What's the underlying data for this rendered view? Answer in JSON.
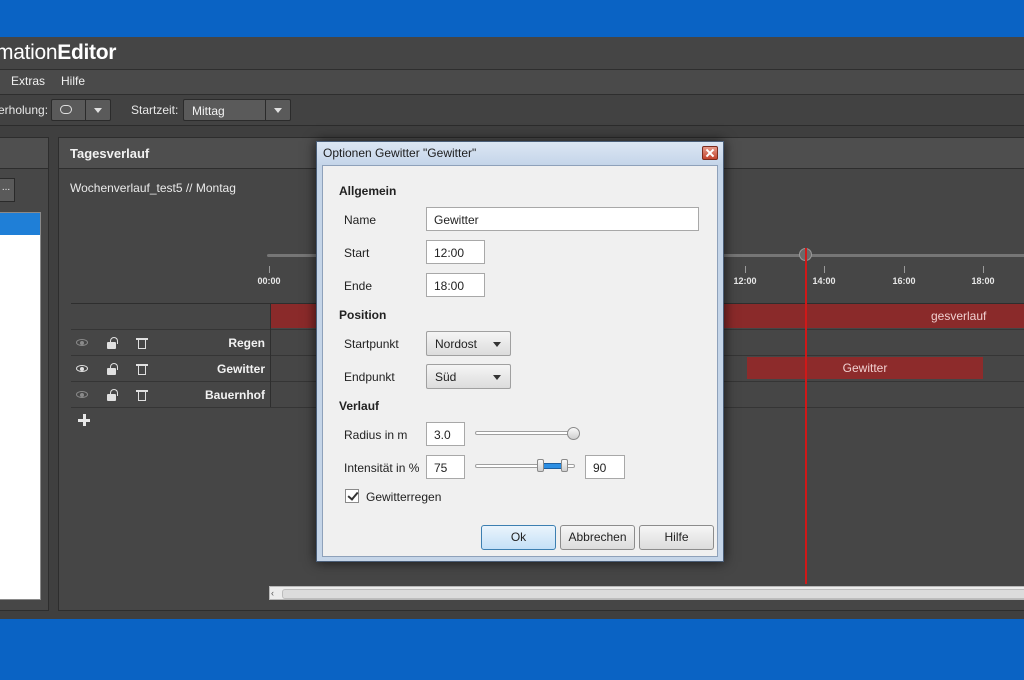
{
  "app": {
    "title_light": "mation",
    "title_bold": "Editor"
  },
  "menu": {
    "items": [
      "Extras",
      "Hilfe"
    ]
  },
  "toolbar": {
    "repeat_label": "erholung:",
    "start_label": "Startzeit:",
    "start_value": "Mittag"
  },
  "left_panel": {
    "button_label": "..."
  },
  "timeline": {
    "title": "Tagesverlauf",
    "subtitle": "Wochenverlauf_test5 // Montag",
    "ticks": [
      "00:00",
      "12:00",
      "14:00",
      "16:00",
      "18:00"
    ],
    "summary_label": "gesverlauf",
    "tracks": [
      {
        "name": "Regen",
        "visible": false
      },
      {
        "name": "Gewitter",
        "visible": true
      },
      {
        "name": "Bauernhof",
        "visible": false
      }
    ],
    "gewitter_bar_label": "Gewitter",
    "bar_color": "#8d2b2b",
    "playhead_color": "#d01818"
  },
  "dialog": {
    "title": "Optionen Gewitter \"Gewitter\"",
    "section_general": "Allgemein",
    "name_label": "Name",
    "name_value": "Gewitter",
    "start_label": "Start",
    "start_value": "12:00",
    "end_label": "Ende",
    "end_value": "18:00",
    "section_position": "Position",
    "startpoint_label": "Startpunkt",
    "startpoint_value": "Nordost",
    "endpoint_label": "Endpunkt",
    "endpoint_value": "Süd",
    "section_course": "Verlauf",
    "radius_label": "Radius in m",
    "radius_value": "3.0",
    "intensity_label": "Intensität in %",
    "intensity_min": "75",
    "intensity_max": "90",
    "rain_label": "Gewitterregen",
    "rain_checked": true,
    "ok_label": "Ok",
    "cancel_label": "Abbrechen",
    "help_label": "Hilfe",
    "accent_color": "#2b8ee3"
  }
}
